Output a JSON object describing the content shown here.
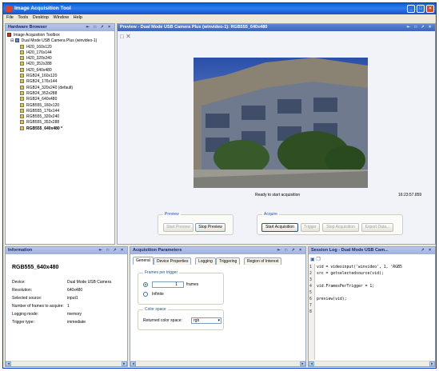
{
  "app": {
    "title": "Image Acquisition Tool"
  },
  "menu": [
    "File",
    "Tools",
    "Desktop",
    "Window",
    "Help"
  ],
  "hardware_browser": {
    "title": "Hardware Browser",
    "root": "Image Acquisition Toolbox",
    "device": "Dual Mode USB Camera Plus (winvideo-1)",
    "formats": [
      "I420_160x120",
      "I420_176x144",
      "I420_320x240",
      "I420_352x288",
      "I420_640x480",
      "RGB24_160x120",
      "RGB24_176x144",
      "RGB24_320x240 (default)",
      "RGB24_352x288",
      "RGB24_640x480",
      "RGB555_160x120",
      "RGB555_176x144",
      "RGB555_320x240",
      "RGB555_352x288",
      "RGB555_640x480 *"
    ],
    "selected_index": 14
  },
  "preview": {
    "title": "Preview - Dual Mode USB Camera Plus (winvideo-1): RGB555_640x480",
    "status": "Ready to start acquisition",
    "timestamp": "16:23:57.859",
    "preview_group": "Preview",
    "acquire_group": "Acquire",
    "buttons": {
      "start_preview": "Start Preview",
      "stop_preview": "Stop Preview",
      "start_acquisition": "Start Acquisition",
      "trigger": "Trigger",
      "stop_acquisition": "Stop Acquisition",
      "export_data": "Export Data..."
    }
  },
  "information": {
    "title": "Information",
    "format": "RGB555_640x480",
    "rows": [
      {
        "label": "Device:",
        "value": "Dual Mode USB Camera"
      },
      {
        "label": "Resolution:",
        "value": "640x480"
      },
      {
        "label": "Selected source:",
        "value": "input1"
      },
      {
        "label": "Number of frames to acquire:",
        "value": "1"
      },
      {
        "label": "Logging mode:",
        "value": "memory"
      },
      {
        "label": "Trigger type:",
        "value": "immediate"
      }
    ]
  },
  "acq_params": {
    "title": "Acquisition Parameters",
    "tabs": [
      "General",
      "Device Properties",
      "Logging",
      "Triggering",
      "Region of Interest"
    ],
    "active_tab": 0,
    "frames_group": "Frames per trigger",
    "frames_value": "1",
    "frames_unit": "frames",
    "infinite_label": "Infinite",
    "color_group": "Color space",
    "color_label": "Returned color space:",
    "color_value": "rgb"
  },
  "session_log": {
    "title": "Session Log - Dual Mode USB Cam...",
    "lines": [
      {
        "n": "1",
        "code": "vid = videoinput('winvideo', 1, 'RGB5"
      },
      {
        "n": "2",
        "code": "src = getselectedsource(vid);"
      },
      {
        "n": "3",
        "code": ""
      },
      {
        "n": "4",
        "code": "vid.FramesPerTrigger = 1;"
      },
      {
        "n": "5",
        "code": ""
      },
      {
        "n": "6",
        "code": "preview(vid);"
      },
      {
        "n": "7",
        "code": ""
      },
      {
        "n": "8",
        "code": ""
      }
    ]
  },
  "icons": {
    "app": "camera-app-icon",
    "save": "save-icon",
    "copy": "copy-icon",
    "fit": "fit-icon",
    "close": "close-icon"
  }
}
